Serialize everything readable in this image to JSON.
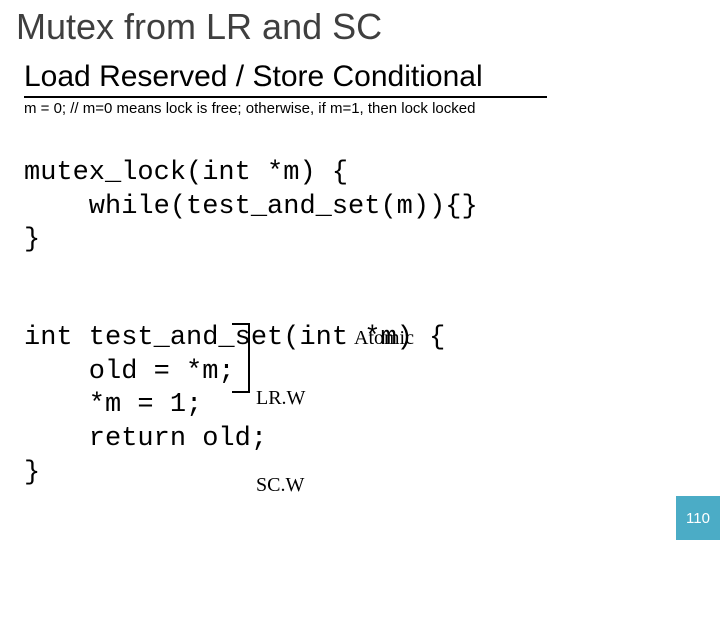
{
  "title": "Mutex from LR and SC",
  "subtitle": "Load Reserved / Store Conditional",
  "comment": "m = 0; // m=0 means lock is free; otherwise, if m=1, then lock locked",
  "code1": {
    "l1": "mutex_lock(int *m) {",
    "l2": "    while(test_and_set(m)){}",
    "l3": "}"
  },
  "code2": {
    "l1": "int test_and_set(int *m) {",
    "l2": "    old = *m;",
    "l3": "    *m = 1;",
    "l4": "    return old;",
    "l5": "}"
  },
  "annotation": {
    "instr1": "LR.W",
    "instr2": "SC.W",
    "atomic": "Atomic"
  },
  "page_number": "110"
}
